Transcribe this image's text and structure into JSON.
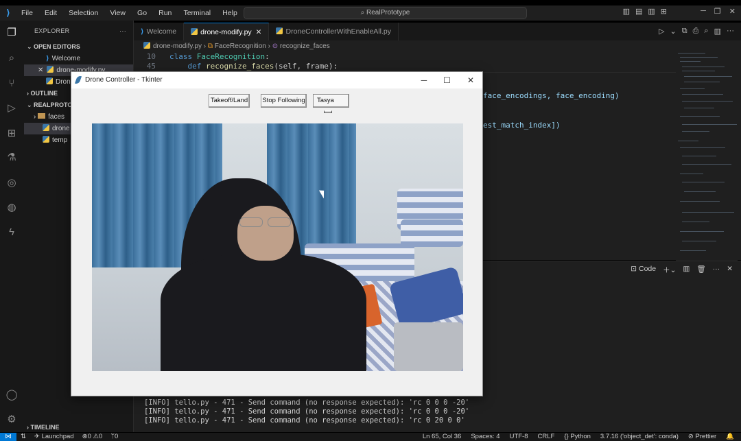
{
  "titlebar": {
    "menu": [
      "File",
      "Edit",
      "Selection",
      "View",
      "Go",
      "Run",
      "Terminal",
      "Help"
    ],
    "search": "RealPrototype"
  },
  "sidebar": {
    "header": "EXPLORER",
    "open_editors_label": "OPEN EDITORS",
    "open_editors": [
      "Welcome",
      "drone-modify.py",
      "Dron"
    ],
    "outline_label": "OUTLINE",
    "project_label": "REALPROTOTY",
    "project_items": [
      "faces",
      "drone",
      "temp"
    ],
    "timeline_label": "TIMELINE"
  },
  "tabs": [
    "Welcome",
    "drone-modify.py",
    "DroneControllerWithEnableAll.py"
  ],
  "breadcrumb": [
    "drone-modify.py",
    "FaceRecognition",
    "recognize_faces"
  ],
  "code": {
    "line1_no": "10",
    "line1_kw": "class",
    "line1_cls": "FaceRecognition",
    "line2_no": "45",
    "line2_kw": "def",
    "line2_fn": "recognize_faces",
    "line2_args": "(self, frame):",
    "visible_1": "face_encodings, face_encoding)",
    "visible_2": "est_match_index])"
  },
  "panel": {
    "code_label": "Code",
    "terminal_lines": [
      "[INFO] tello.py - 471 - Send command (no response expected): 'rc 0 0 0 -20'",
      "[INFO] tello.py - 471 - Send command (no response expected): 'rc 0 0 0 -20'",
      "[INFO] tello.py - 471 - Send command (no response expected): 'rc 0 20 0 0'"
    ]
  },
  "status": {
    "launchpad": "Launchpad",
    "errors": "0",
    "warnings": "0",
    "ports": "0",
    "position": "Ln 65, Col 36",
    "spaces": "Spaces: 4",
    "encoding": "UTF-8",
    "eol": "CRLF",
    "language": "Python",
    "interpreter": "3.7.16 ('object_det': conda)",
    "formatter": "Prettier"
  },
  "tkinter": {
    "title": "Drone Controller - Tkinter",
    "takeoff_label": "Takeoff/Land",
    "stop_label": "Stop Following",
    "target_option": "Tasya"
  },
  "colors": {
    "accent": "#0078d4",
    "editor_bg": "#1f1f1f",
    "sidebar_bg": "#181818"
  }
}
